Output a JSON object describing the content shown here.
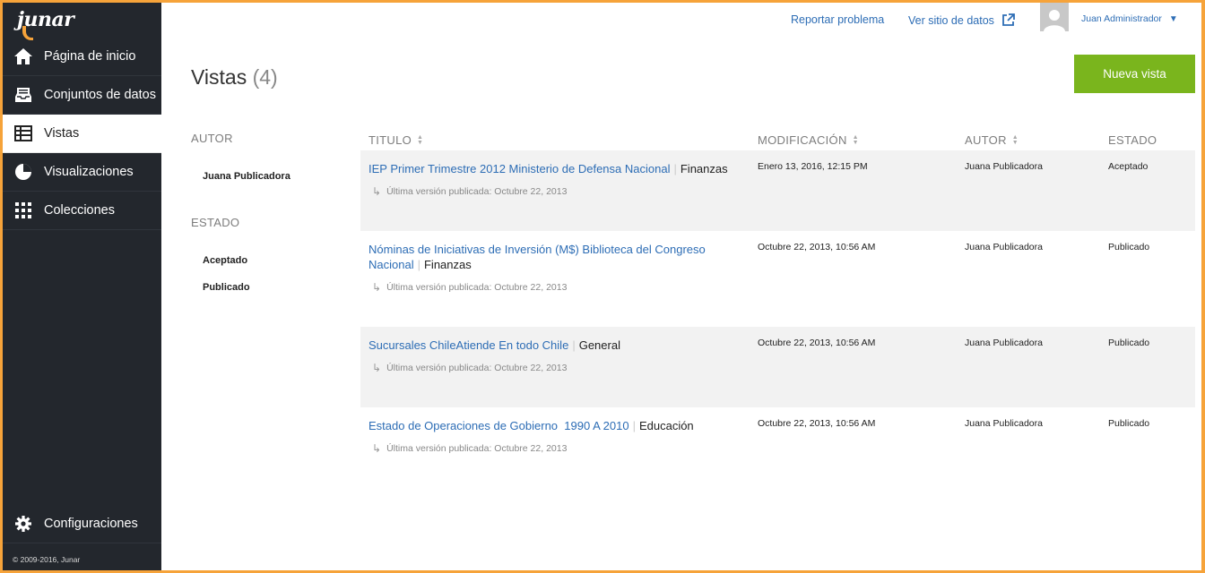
{
  "sidebar": {
    "logo_text": "junar",
    "items": [
      {
        "label": "Página de inicio",
        "icon": "home-icon"
      },
      {
        "label": "Conjuntos de datos",
        "icon": "inbox-icon"
      },
      {
        "label": "Vistas",
        "icon": "table-icon",
        "active": true
      },
      {
        "label": "Visualizaciones",
        "icon": "pie-chart-icon"
      },
      {
        "label": "Colecciones",
        "icon": "grid-icon"
      }
    ],
    "settings_label": "Configuraciones",
    "copyright": "© 2009-2016, Junar"
  },
  "header": {
    "report_link": "Reportar problema",
    "site_link": "Ver sitio de datos",
    "user_name": "Juan Administrador"
  },
  "page": {
    "title": "Vistas",
    "count": "(4)",
    "new_button": "Nueva vista"
  },
  "filters": {
    "author_heading": "AUTOR",
    "authors": [
      "Juana Publicadora"
    ],
    "status_heading": "ESTADO",
    "statuses": [
      "Aceptado",
      "Publicado"
    ]
  },
  "table": {
    "columns": [
      "TITULO",
      "MODIFICACIÓN",
      "AUTOR",
      "ESTADO"
    ],
    "rows": [
      {
        "title": "IEP Primer Trimestre 2012 Ministerio de Defensa Nacional",
        "category": "Finanzas",
        "version": "Última versión publicada: Octubre 22, 2013",
        "modified": "Enero 13, 2016, 12:15 PM",
        "author": "Juana Publicadora",
        "status": "Aceptado"
      },
      {
        "title": "Nóminas de Iniciativas de Inversión (M$) Biblioteca del Congreso Nacional",
        "category": "Finanzas",
        "version": "Última versión publicada: Octubre 22, 2013",
        "modified": "Octubre 22, 2013, 10:56 AM",
        "author": "Juana Publicadora",
        "status": "Publicado"
      },
      {
        "title": "Sucursales ChileAtiende En todo Chile",
        "category": "General",
        "version": "Última versión publicada: Octubre 22, 2013",
        "modified": "Octubre 22, 2013, 10:56 AM",
        "author": "Juana Publicadora",
        "status": "Publicado"
      },
      {
        "title": "Estado de Operaciones de Gobierno  1990 A 2010",
        "category": "Educación",
        "version": "Última versión publicada: Octubre 22, 2013",
        "modified": "Octubre 22, 2013, 10:56 AM",
        "author": "Juana Publicadora",
        "status": "Publicado"
      }
    ]
  },
  "colors": {
    "accent_orange": "#f6a33a",
    "sidebar_bg": "#23272d",
    "link_blue": "#2d6db5",
    "button_green": "#7ab51d",
    "row_shade": "#f2f2f2"
  }
}
